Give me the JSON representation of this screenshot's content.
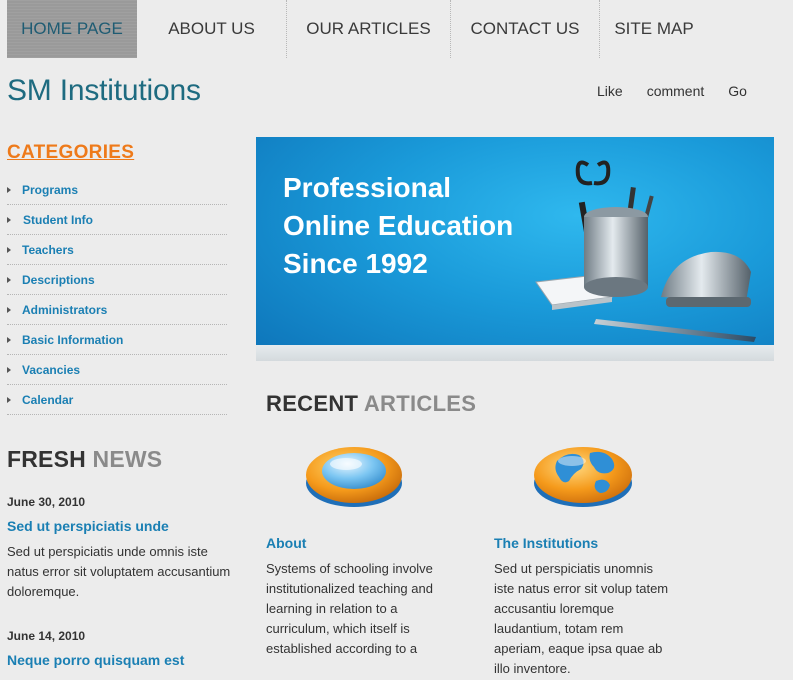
{
  "nav": {
    "items": [
      {
        "label": "HOME PAGE",
        "active": true
      },
      {
        "label": "ABOUT US",
        "active": false
      },
      {
        "label": "OUR ARTICLES",
        "active": false
      },
      {
        "label": "CONTACT US",
        "active": false
      },
      {
        "label": "SITE MAP",
        "active": false
      }
    ]
  },
  "header": {
    "title": "SM Institutions",
    "links": [
      "Like",
      "comment",
      "Go"
    ]
  },
  "sidebar": {
    "categories_title": "CATEGORIES",
    "categories": [
      "Programs",
      "Student Info",
      "Teachers",
      "Descriptions",
      "Administrators",
      "Basic Information",
      "Vacancies",
      "Calendar"
    ],
    "fresh_news_title_a": "FRESH",
    "fresh_news_title_b": "NEWS",
    "news": [
      {
        "date": "June 30, 2010",
        "headline": "Sed ut perspiciatis unde",
        "body": "Sed ut perspiciatis unde omnis iste natus error sit voluptatem accusantium doloremque."
      },
      {
        "date": "June 14, 2010",
        "headline": "Neque porro quisquam est",
        "body": ""
      }
    ]
  },
  "banner": {
    "line1": "Professional",
    "line2": "Online Education",
    "line3": "Since 1992"
  },
  "recent": {
    "title_a": "RECENT",
    "title_b": "ARTICLES",
    "articles": [
      {
        "heading": "About",
        "body": "Systems of schooling involve institutionalized teaching and learning in relation to a curriculum, which itself is established according to a",
        "icon": "magnifier-lens-icon"
      },
      {
        "heading": "The Institutions",
        "body": "Sed ut perspiciatis unomnis iste natus error sit volup tatem accusantiu loremque laudantium, totam rem aperiam, eaque ipsa quae ab illo inventore.",
        "icon": "globe-icon"
      }
    ]
  },
  "colors": {
    "accent_blue": "#1a7fb3",
    "title_teal": "#1e6b80",
    "categories_orange": "#ee7a1a"
  }
}
